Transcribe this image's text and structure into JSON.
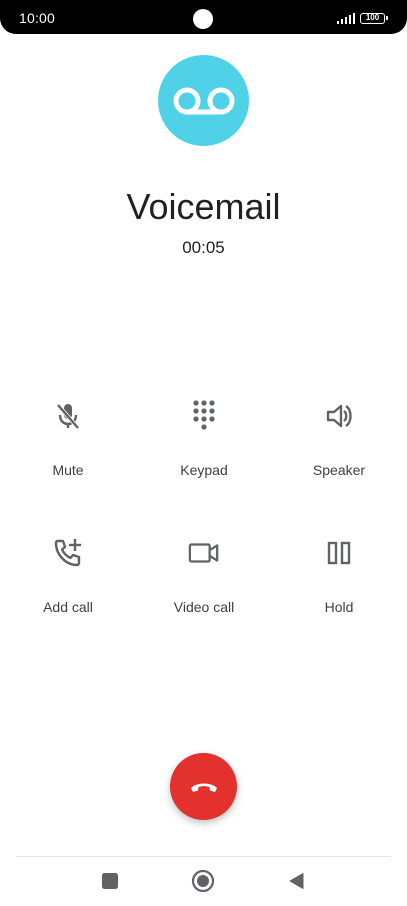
{
  "status_bar": {
    "time": "10:00",
    "battery_level": "100",
    "signal_icon": "signal-bars-icon",
    "battery_icon": "battery-icon"
  },
  "call": {
    "avatar_icon": "voicemail-icon",
    "avatar_color": "#4fd1e8",
    "name": "Voicemail",
    "timer": "00:05"
  },
  "controls": [
    {
      "label": "Mute",
      "icon": "mic-off-icon"
    },
    {
      "label": "Keypad",
      "icon": "dialpad-icon"
    },
    {
      "label": "Speaker",
      "icon": "speaker-icon"
    },
    {
      "label": "Add call",
      "icon": "add-call-icon"
    },
    {
      "label": "Video call",
      "icon": "video-camera-icon"
    },
    {
      "label": "Hold",
      "icon": "pause-icon"
    }
  ],
  "end_call": {
    "icon": "hang-up-icon",
    "color": "#e3312d"
  },
  "navigation": {
    "recents_icon": "square-icon",
    "home_icon": "circle-icon",
    "back_icon": "triangle-back-icon"
  }
}
